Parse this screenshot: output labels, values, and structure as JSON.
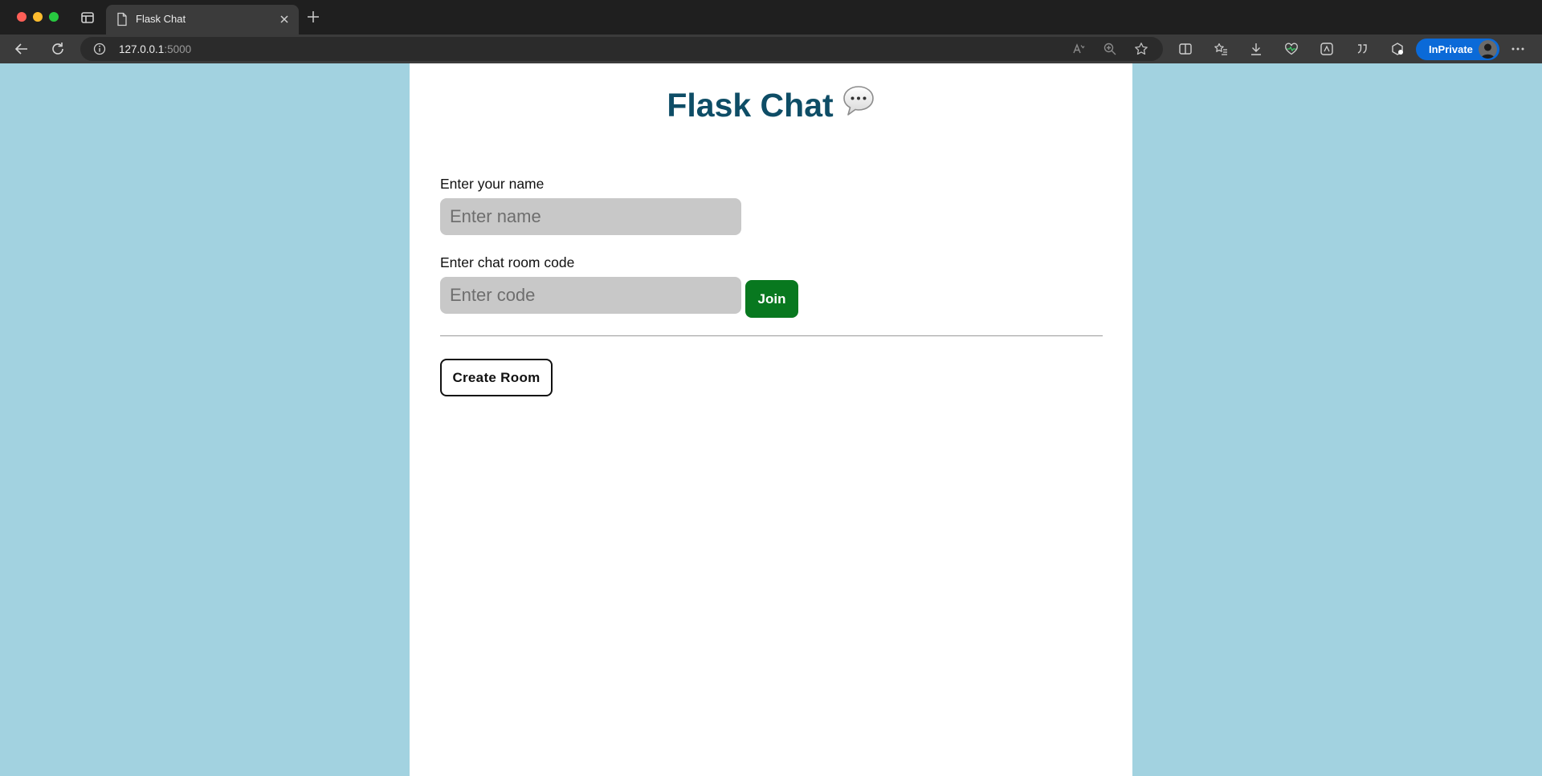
{
  "browser": {
    "tab_title": "Flask Chat",
    "url_host": "127.0.0.1",
    "url_port": ":5000",
    "inprivate_label": "InPrivate"
  },
  "page": {
    "title": "Flask Chat",
    "title_icon": "speech-bubble-icon",
    "name_label": "Enter your name",
    "name_placeholder": "Enter name",
    "code_label": "Enter chat room code",
    "code_placeholder": "Enter code",
    "join_label": "Join",
    "create_label": "Create Room"
  },
  "colors": {
    "page_background": "#a2d2e0",
    "title": "#0e4d66",
    "join_button": "#08781f",
    "input_background": "#c8c8c8",
    "inprivate_badge": "#0b6ad8"
  }
}
